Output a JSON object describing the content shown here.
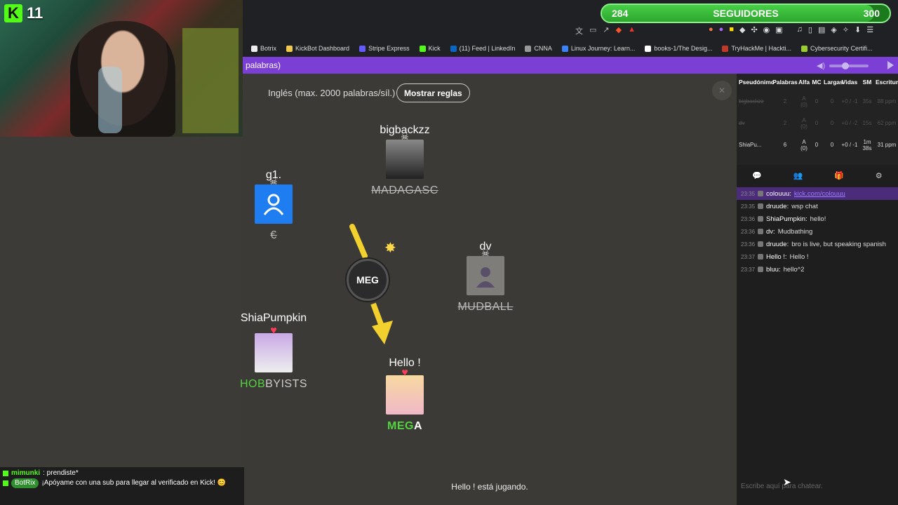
{
  "stream": {
    "viewers": "11",
    "followers": {
      "current": "284",
      "label": "SEGUIDORES",
      "goal": "300",
      "progress": 0.947
    }
  },
  "bookmarks": [
    {
      "label": "Botrix",
      "color": "#eeeeee"
    },
    {
      "label": "KickBot Dashboard",
      "color": "#f2c94c"
    },
    {
      "label": "Stripe Express",
      "color": "#635bff"
    },
    {
      "label": "Kick",
      "color": "#53fc18"
    },
    {
      "label": "(11) Feed | LinkedIn",
      "color": "#0a66c2"
    },
    {
      "label": "CNNA",
      "color": "#999999"
    },
    {
      "label": "Linux Journey: Learn...",
      "color": "#3b82f6"
    },
    {
      "label": "books-1/The Desig...",
      "color": "#ffffff"
    },
    {
      "label": "TryHackMe | Hackti...",
      "color": "#c0392b"
    },
    {
      "label": "Cybersecurity Certifi...",
      "color": "#9acd32"
    }
  ],
  "game": {
    "header_text": "palabras)",
    "language_label": "Inglés (max. 2000 palabras/síl.)",
    "rules_button": "Mostrar reglas",
    "close": "✕",
    "bomb_syllable": "MEG",
    "status": "Hello ! está jugando.",
    "players": [
      {
        "name": "bigbackzz",
        "word": "MADAGASC",
        "dead": true
      },
      {
        "name": "g1.",
        "word": "€",
        "dead": true
      },
      {
        "name": "dv",
        "word_hl": "MUD",
        "word_rest": "BALL",
        "dead": true
      },
      {
        "name": "ShiaPumpkin",
        "word_hl": "HOB",
        "word_rest": "BYISTS",
        "dead": false
      },
      {
        "name": "Hello !",
        "word_hl": "MEG",
        "word_rest": "A",
        "dead": false
      }
    ]
  },
  "scoreboard": {
    "headers": [
      "Pseudónimo",
      "Palabras",
      "Alfa",
      "MC",
      "Largas",
      "Vidas",
      "SM",
      "Escritura"
    ],
    "rows": [
      {
        "name": "bigbackzz",
        "words": "2",
        "alfa": "A (0)",
        "mc": "0",
        "largas": "0",
        "vidas": "+0 / -1",
        "sm": "35s",
        "esc": "88 ppm",
        "dead": true
      },
      {
        "name": "dv",
        "words": "2",
        "alfa": "A (0)",
        "mc": "0",
        "largas": "0",
        "vidas": "+0 / -2",
        "sm": "15s",
        "esc": "62 ppm",
        "dead": true
      },
      {
        "name": "ShiaPu...",
        "words": "6",
        "alfa": "A (0)",
        "mc": "0",
        "largas": "0",
        "vidas": "+0 / -1",
        "sm": "1m 38s",
        "esc": "31 ppm",
        "dead": false
      }
    ]
  },
  "panel_tabs": [
    "chat-icon",
    "people-icon",
    "gift-icon",
    "settings-icon"
  ],
  "chat": [
    {
      "time": "23:35",
      "user": "colouuu:",
      "text": "kick.com/colouuu",
      "link": true
    },
    {
      "time": "23:35",
      "user": "druude:",
      "text": "wsp chat"
    },
    {
      "time": "23:36",
      "user": "ShiaPumpkin:",
      "text": "hello!"
    },
    {
      "time": "23:36",
      "user": "dv:",
      "text": "Mudbathing"
    },
    {
      "time": "23:36",
      "user": "druude:",
      "text": "bro is live, but speaking spanish"
    },
    {
      "time": "23:37",
      "user": "Hello !:",
      "text": "Hello !"
    },
    {
      "time": "23:37",
      "user": "bluu:",
      "text": "hello^2"
    }
  ],
  "chat_input_placeholder": "Escribe aquí para chatear.",
  "overlay_chat": [
    {
      "user": "mimunki",
      "text": ": prendiste*"
    },
    {
      "user": "BotRix",
      "text": "¡Apóyame con una sub para llegar al verificado en Kick! 😊"
    }
  ]
}
